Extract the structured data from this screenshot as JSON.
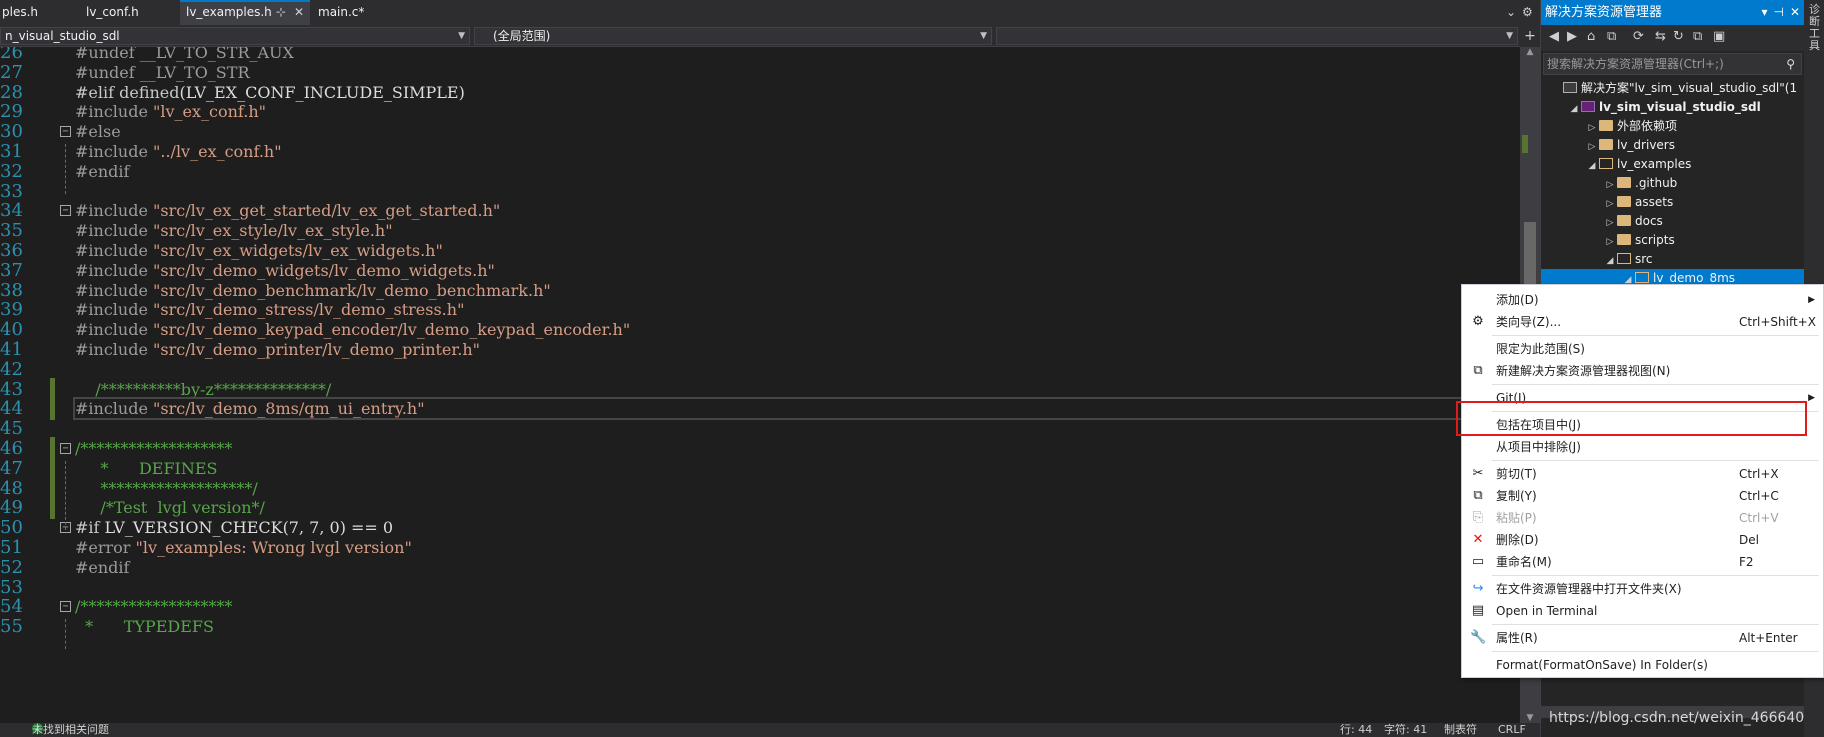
{
  "tabs": [
    {
      "label": "ples.h",
      "active": false
    },
    {
      "label": "lv_conf.h",
      "active": false
    },
    {
      "label": "lv_examples.h",
      "active": true,
      "pin": "⊹",
      "close": "✕"
    },
    {
      "label": "main.c*",
      "active": false
    }
  ],
  "tabbar_right": {
    "menu": "⌄",
    "settings": "⚙"
  },
  "navbar": {
    "project": "n_visual_studio_sdl",
    "scope": "(全局范围)",
    "member": "",
    "split": "+"
  },
  "code_lines": [
    {
      "n": "26",
      "text": "#undef __LV_TO_STR_AUX"
    },
    {
      "n": "27",
      "text": "#undef __LV_TO_STR"
    },
    {
      "n": "28",
      "pre": "#elif defined",
      "rest": "(LV_EX_CONF_INCLUDE_SIMPLE)"
    },
    {
      "n": "29",
      "pre": "#include ",
      "str": "\"lv_ex_conf.h\""
    },
    {
      "n": "30",
      "text": "#else"
    },
    {
      "n": "31",
      "pre": "#include ",
      "str": "\"../lv_ex_conf.h\""
    },
    {
      "n": "32",
      "text": "#endif"
    },
    {
      "n": "33",
      "text": ""
    },
    {
      "n": "34",
      "pre": "#include ",
      "str": "\"src/lv_ex_get_started/lv_ex_get_started.h\""
    },
    {
      "n": "35",
      "pre": "#include ",
      "str": "\"src/lv_ex_style/lv_ex_style.h\""
    },
    {
      "n": "36",
      "pre": "#include ",
      "str": "\"src/lv_ex_widgets/lv_ex_widgets.h\""
    },
    {
      "n": "37",
      "pre": "#include ",
      "str": "\"src/lv_demo_widgets/lv_demo_widgets.h\""
    },
    {
      "n": "38",
      "pre": "#include ",
      "str": "\"src/lv_demo_benchmark/lv_demo_benchmark.h\""
    },
    {
      "n": "39",
      "pre": "#include ",
      "str": "\"src/lv_demo_stress/lv_demo_stress.h\""
    },
    {
      "n": "40",
      "pre": "#include ",
      "str": "\"src/lv_demo_keypad_encoder/lv_demo_keypad_encoder.h\""
    },
    {
      "n": "41",
      "pre": "#include ",
      "str": "\"src/lv_demo_printer/lv_demo_printer.h\""
    },
    {
      "n": "42",
      "text": ""
    },
    {
      "n": "43",
      "cmt": "    /**********by-z**************/"
    },
    {
      "n": "44",
      "pre": "#include ",
      "str": "\"src/lv_demo_8ms/qm_ui_entry.h\""
    },
    {
      "n": "45",
      "text": ""
    },
    {
      "n": "46",
      "cmt": "/*******************"
    },
    {
      "n": "47",
      "cmt": "     *      DEFINES"
    },
    {
      "n": "48",
      "cmt": "     *******************/"
    },
    {
      "n": "49",
      "cmt": "     /*Test  lvgl version*/"
    },
    {
      "n": "50",
      "pre": "#if ",
      "rest": "LV_VERSION_CHECK(7, 7, 0) == 0"
    },
    {
      "n": "51",
      "pre": "#error ",
      "str": "\"lv_examples: Wrong lvgl version\""
    },
    {
      "n": "52",
      "text": "#endif"
    },
    {
      "n": "53",
      "text": ""
    },
    {
      "n": "54",
      "cmt": "/*******************"
    },
    {
      "n": "55",
      "cmt": "  *      TYPEDEFS"
    }
  ],
  "statusbar": {
    "issues": "未找到相关问题",
    "line": "行: 44",
    "char": "字符: 41",
    "tabs": "制表符",
    "eol": "CRLF"
  },
  "solution_explorer": {
    "title": "解决方案资源管理器",
    "title_buttons": [
      "▾",
      "⊣",
      "✕"
    ],
    "side_label": "诊断工具",
    "toolbar_icons": [
      "◀",
      "▶",
      "⌂",
      "⧉",
      "⟳",
      "⇆",
      "↻",
      "⧉",
      "▣"
    ],
    "search_placeholder": "搜索解决方案资源管理器(Ctrl+;)",
    "search_icon": "⚲",
    "tree": [
      {
        "label": "解决方案\"lv_sim_visual_studio_sdl\"(1",
        "depth": 0,
        "exp": "",
        "icon": "sln"
      },
      {
        "label": "lv_sim_visual_studio_sdl",
        "depth": 1,
        "exp": "◢",
        "icon": "proj",
        "bold": true
      },
      {
        "label": "外部依赖项",
        "depth": 2,
        "exp": "▷",
        "icon": "folder"
      },
      {
        "label": "lv_drivers",
        "depth": 2,
        "exp": "▷",
        "icon": "folder"
      },
      {
        "label": "lv_examples",
        "depth": 2,
        "exp": "◢",
        "icon": "folder-open"
      },
      {
        "label": ".github",
        "depth": 3,
        "exp": "▷",
        "icon": "folder"
      },
      {
        "label": "assets",
        "depth": 3,
        "exp": "▷",
        "icon": "folder"
      },
      {
        "label": "docs",
        "depth": 3,
        "exp": "▷",
        "icon": "folder"
      },
      {
        "label": "scripts",
        "depth": 3,
        "exp": "▷",
        "icon": "folder"
      },
      {
        "label": "src",
        "depth": 3,
        "exp": "◢",
        "icon": "folder-open"
      },
      {
        "label": "lv_demo_8ms",
        "depth": 4,
        "exp": "◢",
        "icon": "folder-open",
        "selected": true
      }
    ],
    "watermark": "https://blog.csdn.net/weixin_46664039"
  },
  "context_menu": {
    "items": [
      {
        "label": "添加(D)",
        "key": "",
        "icon": "",
        "submenu": true
      },
      {
        "label": "类向导(Z)...",
        "key": "Ctrl+Shift+X",
        "icon": "⚙"
      },
      {
        "sep": true
      },
      {
        "label": "限定为此范围(S)",
        "key": "",
        "icon": ""
      },
      {
        "label": "新建解决方案资源管理器视图(N)",
        "key": "",
        "icon": "⧉"
      },
      {
        "sep": true
      },
      {
        "label": "Git(I)",
        "key": "",
        "icon": "",
        "submenu": true
      },
      {
        "sep": true
      },
      {
        "label": "包括在项目中(J)",
        "key": "",
        "icon": ""
      },
      {
        "label": "从项目中排除(J)",
        "key": "",
        "icon": ""
      },
      {
        "sep": true
      },
      {
        "label": "剪切(T)",
        "key": "Ctrl+X",
        "icon": "✂"
      },
      {
        "label": "复制(Y)",
        "key": "Ctrl+C",
        "icon": "⧉"
      },
      {
        "label": "粘贴(P)",
        "key": "Ctrl+V",
        "icon": "⎘",
        "disabled": true
      },
      {
        "label": "删除(D)",
        "key": "Del",
        "icon": "✕",
        "iconColor": "#e51400"
      },
      {
        "label": "重命名(M)",
        "key": "F2",
        "icon": "▭"
      },
      {
        "sep": true
      },
      {
        "label": "在文件资源管理器中打开文件夹(X)",
        "key": "",
        "icon": "↪",
        "iconColor": "#1e90ff"
      },
      {
        "label": "Open in Terminal",
        "key": "",
        "icon": "▤"
      },
      {
        "sep": true
      },
      {
        "label": "属性(R)",
        "key": "Alt+Enter",
        "icon": "🔧"
      },
      {
        "sep": true
      },
      {
        "label": "Format(FormatOnSave) In Folder(s)",
        "key": "",
        "icon": ""
      }
    ],
    "highlight_color": "#e01b1b"
  },
  "colors": {
    "accent": "#007acc",
    "preprocessor": "#9b9b9b",
    "string": "#d69d85",
    "comment": "#57a64a",
    "line_number": "#2b91af"
  }
}
